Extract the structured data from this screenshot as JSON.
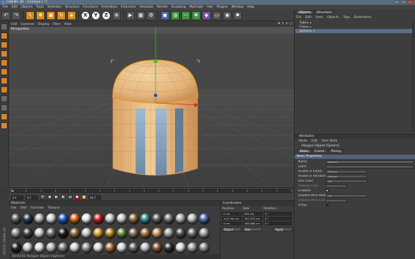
{
  "window": {
    "title": "CINEMA 4D - [Untitled 1 *]"
  },
  "menu": [
    "File",
    "Edit",
    "Objects",
    "Tools",
    "Selection",
    "Structure",
    "Functions",
    "Animation",
    "Character",
    "Simulate",
    "Render",
    "Sculpting",
    "MoGraph",
    "Hair",
    "Plugins",
    "Window",
    "Help"
  ],
  "toolbar": {
    "undo_icon": "undo-icon",
    "axes": [
      "X",
      "Y",
      "Z"
    ]
  },
  "viewport": {
    "menu": [
      "Edit",
      "Cameras",
      "Display",
      "Filter",
      "View"
    ],
    "label": "Perspective",
    "nav_icons": [
      "move-view-icon",
      "zoom-view-icon",
      "rotate-view-icon",
      "maximize-view-icon"
    ]
  },
  "timeline": {
    "frame_field": "0 F",
    "start_field": "0 F",
    "end_field": "90 F"
  },
  "materials": {
    "title": "Materials",
    "menu": [
      "File",
      "Edit",
      "Function",
      "Texture"
    ],
    "swatches": [
      "#5a5a5a",
      "#273854",
      "#b0b0b0",
      "#d0d0d0",
      "#1f5fd0",
      "#d96818",
      "#e6e6e6",
      "#c02020",
      "#c8c8c8",
      "#c7c7c7",
      "#8a6b3a",
      "#2a8f8a",
      "#5c5c5c",
      "#707070",
      "#aaaaaa",
      "#b8b8b8",
      "#4c6ba8",
      "#8a8a8a",
      "#3d3d3d",
      "#c9c9c9",
      "#6b6b6b",
      "#1b1b1b",
      "#8c6a3c",
      "#c8c8c8",
      "#d19c2a",
      "#b28a1a",
      "#5a8a3a",
      "#7a6a5a",
      "#a66f37",
      "#c49463",
      "#9c9c9c",
      "#4b4b4b",
      "#6c6c6c",
      "#a0a0a0",
      "#222222",
      "#c6c6c6",
      "#dcdcdc",
      "#b3b3b3",
      "#7b7b7b",
      "#cfcfcf",
      "#8e8e8e",
      "#d7d7d7",
      "#a96a34",
      "#d4d4d4",
      "#646464",
      "#bdbdbd",
      "#7c5434",
      "#303030",
      "#d9d9d9",
      "#9a9a9a",
      "#888888"
    ]
  },
  "coordinates": {
    "title": "Coordinates",
    "headers": [
      "Position",
      "Size",
      "Rotation"
    ],
    "rows": [
      {
        "pos": "0 cm",
        "size": "200 cm",
        "rot": "0 °"
      },
      {
        "pos": "113.744 cm",
        "size": "167.512 cm",
        "rot": "0 °"
      },
      {
        "pos": "0 cm",
        "size": "185.568 cm",
        "rot": "0 °"
      }
    ],
    "object_button": "Object",
    "size_button": "Size",
    "apply_button": "Apply"
  },
  "status": {
    "text": "00:00:01   Polygon Object [Sphere]",
    "side_text": "MAXON CINEMA 4D"
  },
  "objects_panel": {
    "tabs": [
      "Objects",
      "Structure"
    ],
    "menu": [
      "File",
      "Edit",
      "View",
      "Objects",
      "Tags",
      "Bookmarks"
    ],
    "items": [
      {
        "name": "Tube"
      },
      {
        "name": "Floor"
      },
      {
        "name": "Sphere"
      }
    ]
  },
  "attributes": {
    "title": "Attributes",
    "menu": [
      "Mode",
      "Edit",
      "User Data"
    ],
    "object_label": "Polygon Object [Sphere]",
    "tabs": [
      "Basic",
      "Coord.",
      "Phong"
    ],
    "section": "Basic Properties",
    "rows": [
      {
        "label": "Name",
        "value": "Sphere"
      },
      {
        "label": "Layer",
        "value": ""
      },
      {
        "label": "Visible in Editor",
        "value": "Default"
      },
      {
        "label": "Visible in Renderer",
        "value": "Default"
      },
      {
        "label": "Use Color",
        "value": "Off"
      },
      {
        "label": "Display Color",
        "value": ""
      },
      {
        "label": "Enabled",
        "value": ""
      },
      {
        "label": "Shaded Wire Mode",
        "value": "Off"
      },
      {
        "label": "Shaded Wire Color",
        "value": ""
      },
      {
        "label": "X-Ray",
        "value": ""
      }
    ]
  }
}
